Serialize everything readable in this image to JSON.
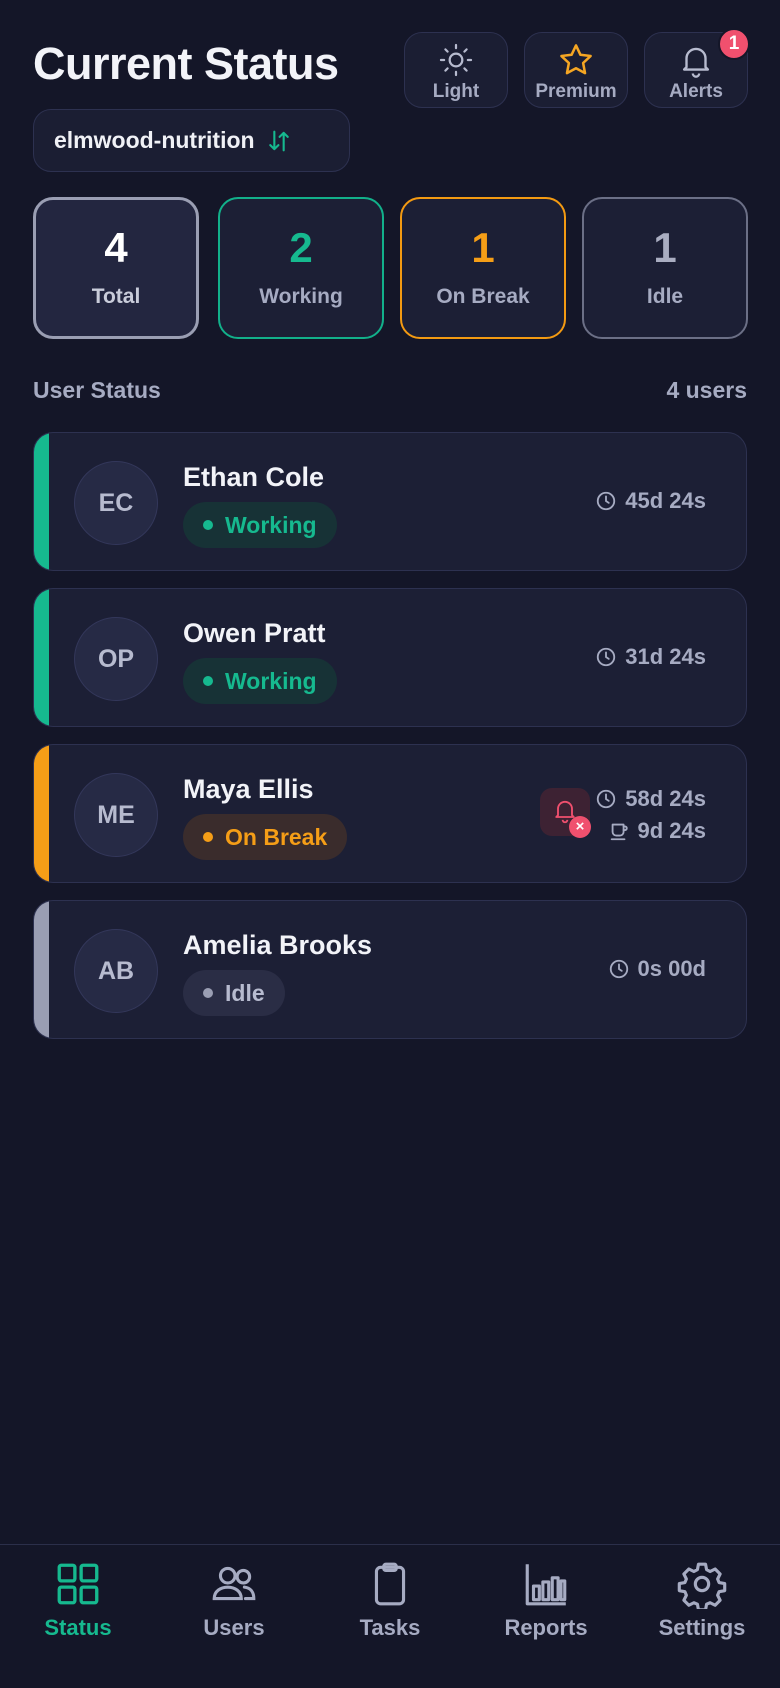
{
  "header": {
    "title": "Current Status",
    "buttons": [
      {
        "label": "Light",
        "icon": "sun-icon"
      },
      {
        "label": "Premium",
        "icon": "star-icon"
      },
      {
        "label": "Alerts",
        "icon": "bell-icon",
        "badge": "1"
      }
    ]
  },
  "org": {
    "name": "elmwood-nutrition",
    "icon": "swap-vertical-icon"
  },
  "stats": [
    {
      "value": "4",
      "label": "Total"
    },
    {
      "value": "2",
      "label": "Working"
    },
    {
      "value": "1",
      "label": "On Break"
    },
    {
      "value": "1",
      "label": "Idle"
    }
  ],
  "section": {
    "title": "User Status",
    "count": "4 users"
  },
  "users": [
    {
      "initials": "EC",
      "name": "Ethan Cole",
      "status": "Working",
      "time": "45d 24s"
    },
    {
      "initials": "OP",
      "name": "Owen Pratt",
      "status": "Working",
      "time": "31d 24s"
    },
    {
      "initials": "ME",
      "name": "Maya Ellis",
      "status": "On Break",
      "time": "58d 24s",
      "break_time": "9d 24s",
      "alert_icon": "bell-off-alert-icon"
    },
    {
      "initials": "AB",
      "name": "Amelia Brooks",
      "status": "Idle",
      "time": "0s 00d"
    }
  ],
  "colors": {
    "background": "#141628",
    "working": "#16b98f",
    "on_break": "#f59e17",
    "idle": "#9a9eb3",
    "alert": "#f0506e"
  },
  "nav": [
    {
      "label": "Status",
      "icon": "grid-icon",
      "active": true
    },
    {
      "label": "Users",
      "icon": "users-icon"
    },
    {
      "label": "Tasks",
      "icon": "clipboard-icon"
    },
    {
      "label": "Reports",
      "icon": "bar-chart-icon"
    },
    {
      "label": "Settings",
      "icon": "gear-icon"
    }
  ]
}
